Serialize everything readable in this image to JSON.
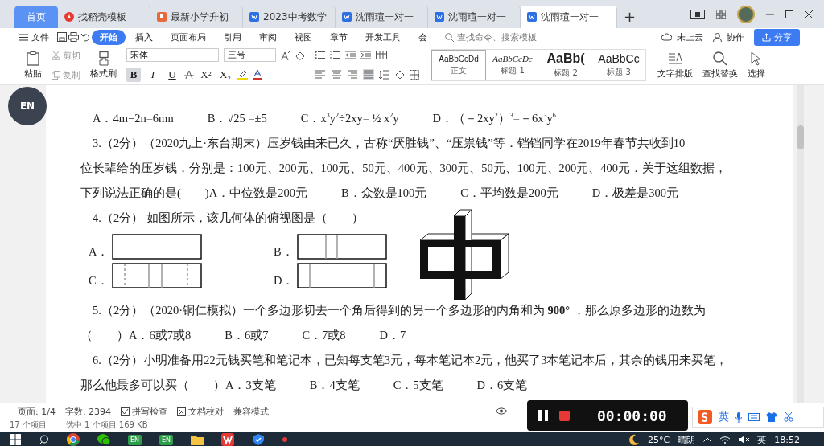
{
  "tabs": [
    {
      "label": "首页",
      "kind": "home",
      "selected": false
    },
    {
      "label": "找稻壳模板",
      "kind": "docer",
      "selected": false
    },
    {
      "label": "最新小学升初",
      "kind": "ppt",
      "selected": false
    },
    {
      "label": "2023中考数学",
      "kind": "doc",
      "selected": false
    },
    {
      "label": "沈雨瑄一对一",
      "kind": "doc",
      "selected": false
    },
    {
      "label": "沈雨瑄一对一",
      "kind": "doc",
      "selected": false
    },
    {
      "label": "沈雨瑄一对一",
      "kind": "doc",
      "selected": true
    }
  ],
  "new_tab": "+",
  "menu": {
    "file": "文件",
    "items": [
      {
        "label": "开始",
        "selected": true
      },
      {
        "label": "插入",
        "selected": false
      },
      {
        "label": "页面布局",
        "selected": false
      },
      {
        "label": "引用",
        "selected": false
      },
      {
        "label": "审阅",
        "selected": false
      },
      {
        "label": "视图",
        "selected": false
      },
      {
        "label": "章节",
        "selected": false
      },
      {
        "label": "开发工具",
        "selected": false
      },
      {
        "label": "会",
        "selected": false
      }
    ],
    "search_placeholder": "查找命令、搜索模板",
    "cloud": "未上云",
    "collab": "协作",
    "share": "分享"
  },
  "ribbon": {
    "paste": "粘贴",
    "cut": "剪切",
    "copy": "复制",
    "format_painter": "格式刷",
    "font": "宋体",
    "size": "三号",
    "format_buttons": [
      {
        "label": "B",
        "active": true
      },
      {
        "label": "I",
        "active": false
      },
      {
        "label": "U",
        "active": false
      }
    ],
    "scripts": [
      "X²",
      "X₂"
    ],
    "justify_active": true,
    "styles": [
      {
        "sample": "AaBbCcDd",
        "name": "正文",
        "kind": "body",
        "selected": true
      },
      {
        "sample": "AaBbCcDc",
        "name": "标题 1",
        "kind": "h1",
        "selected": false
      },
      {
        "sample": "AaBb(",
        "name": "标题 2",
        "kind": "h2",
        "selected": false
      },
      {
        "sample": "AaBbCc",
        "name": "标题 3",
        "kind": "h3",
        "selected": false
      }
    ],
    "text_layout": "文字排版",
    "find_replace": "查找替换",
    "select": "选择"
  },
  "floating_badge": "EN",
  "document": {
    "blocks": [
      {
        "kind": "paragraph",
        "lines": [
          [
            "A．4m−2n=6mn",
            "B．√25 =±5",
            "C．x$^{3}$y$^{2}$÷2xy= ½ x$^{2}$y",
            "D．（－2xy$^{2}$）$^{3}$=－6x$^{3}$y$^{6}$"
          ]
        ]
      },
      {
        "kind": "paragraph",
        "lines": [
          [
            "3.（2分）（2020九上·东台期末）压岁钱由来已久，古称“厌胜钱”、“压祟钱”等．铛铛同学在2019年春节共收到10"
          ],
          [
            "位长辈给的压岁钱，分别是：100元、200元、100元、50元、400元、300元、50元、100元、200元、400元．关于这组数据，"
          ],
          [
            "下列说法正确的是(　　)A．中位数是200元",
            "B．众数是100元",
            "C．平均数是200元",
            "D．极差是300元"
          ]
        ]
      },
      {
        "kind": "paragraph",
        "lines": [
          [
            "4.（2分） 如图所示，该几何体的俯视图是（　　）"
          ]
        ]
      },
      {
        "kind": "figures",
        "options": [
          {
            "label": "A．",
            "kind": "plain"
          },
          {
            "label": "B．",
            "kind": "center-lines"
          },
          {
            "label": "C．",
            "kind": "dashed"
          },
          {
            "label": "D．",
            "kind": "edge-lines"
          }
        ]
      },
      {
        "kind": "paragraph",
        "lines": [
          [
            "5.（2分）（2020·铜仁模拟）一个多边形切去一个角后得到的另一个多边形的内角和为 **900°** ，那么原多边形的边数为"
          ],
          [
            "（　　）A．6或7或8",
            "B．6或7",
            "C．7或8",
            "D．7"
          ]
        ]
      },
      {
        "kind": "paragraph",
        "lines": [
          [
            "6.（2分）小明准备用22元钱买笔和笔记本，已知每支笔3元，每本笔记本2元，他买了3本笔记本后，其余的钱用来买笔，"
          ],
          [
            "那么他最多可以买（　　）A．3支笔",
            "B．4支笔",
            "C．5支笔",
            "D．6支笔"
          ]
        ]
      }
    ]
  },
  "status": {
    "page": "页面: 1/4",
    "words": "字数: 2394",
    "spell": "拼写检查",
    "proof": "文档校对",
    "compat": "兼容模式"
  },
  "explorer_status": [
    "17 个项目",
    "选中 1 个项目 169 KB"
  ],
  "recorder": {
    "time": "00:00:00"
  },
  "ime": {
    "mode": "英"
  },
  "taskbar": {
    "apps": [
      {
        "kind": "chrome"
      },
      {
        "kind": "wechat"
      },
      {
        "kind": "en",
        "label": "EN"
      },
      {
        "kind": "en",
        "label": "EN"
      },
      {
        "kind": "folder"
      },
      {
        "kind": "wps"
      },
      {
        "kind": "shield"
      },
      {
        "kind": "dot"
      }
    ],
    "temperature": "25°C",
    "weather": "晴朗",
    "lang": "英",
    "time": "18:52"
  }
}
